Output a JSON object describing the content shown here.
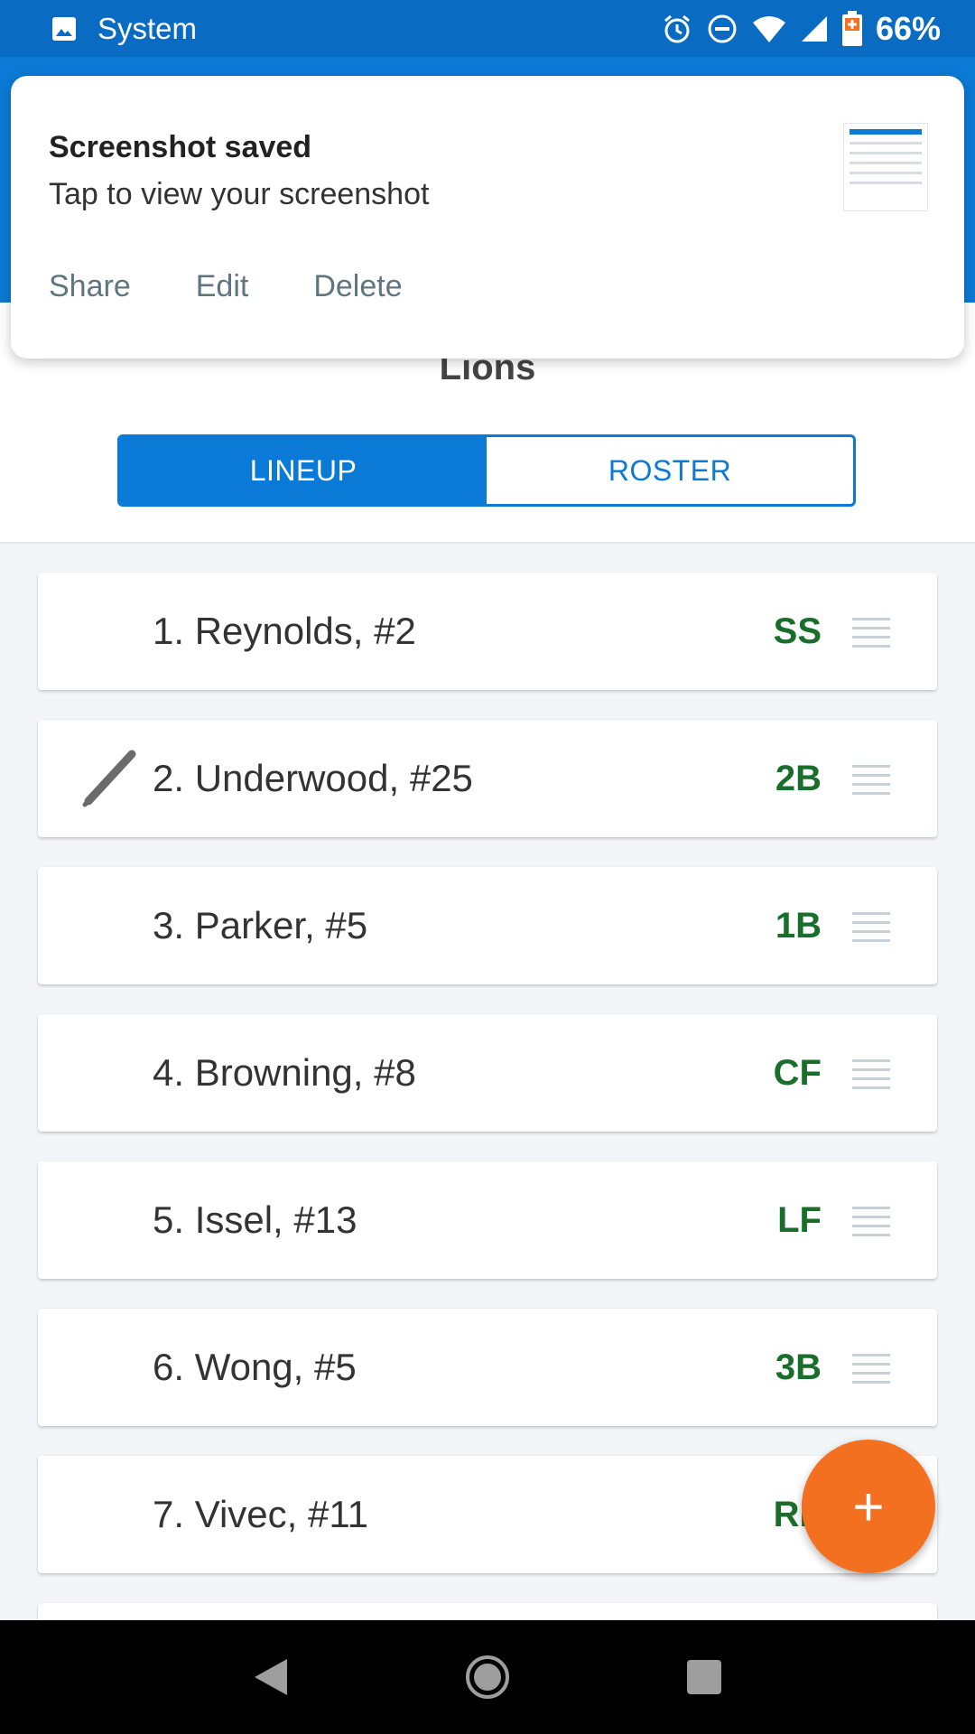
{
  "status_bar": {
    "app_label": "System",
    "battery": "66%",
    "icons": [
      "image-icon",
      "alarm-icon",
      "do-not-disturb-icon",
      "wifi-icon",
      "signal-icon",
      "battery-icon"
    ]
  },
  "notification": {
    "title": "Screenshot saved",
    "text": "Tap to view your screenshot",
    "actions": [
      "Share",
      "Edit",
      "Delete"
    ]
  },
  "team": {
    "name": "Lions"
  },
  "tabs": [
    {
      "label": "LINEUP",
      "active": true
    },
    {
      "label": "ROSTER",
      "active": false
    }
  ],
  "lineup": [
    {
      "label": "1. Reynolds, #2",
      "position": "SS",
      "batting": false
    },
    {
      "label": "2. Underwood, #25",
      "position": "2B",
      "batting": true
    },
    {
      "label": "3. Parker, #5",
      "position": "1B",
      "batting": false
    },
    {
      "label": "4. Browning, #8",
      "position": "CF",
      "batting": false
    },
    {
      "label": "5. Issel, #13",
      "position": "LF",
      "batting": false
    },
    {
      "label": "6. Wong, #5",
      "position": "3B",
      "batting": false
    },
    {
      "label": "7. Vivec, #11",
      "position": "RF",
      "batting": false
    }
  ],
  "fab": {
    "label": "+"
  },
  "colors": {
    "primary": "#0b7ad6",
    "accent": "#f37021",
    "position_text": "#1a6e2b"
  }
}
